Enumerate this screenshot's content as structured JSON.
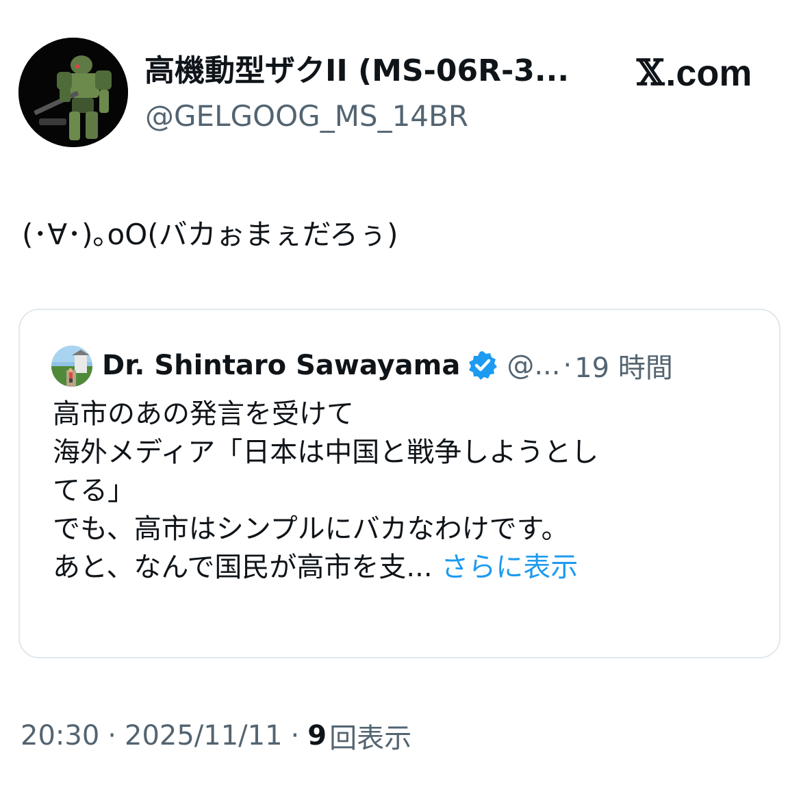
{
  "author": {
    "display_name": "高機動型ザクII (MS-06R-3...",
    "handle": "@GELGOOG_MS_14BR",
    "avatar_icon": "mobile-suit-avatar-icon"
  },
  "brand": {
    "x_symbol": "𝕏",
    "domain": ".com"
  },
  "tweet": {
    "text": "(･∀･)｡oO(バカぉまぇだろぅ)"
  },
  "quote": {
    "avatar_icon": "person-on-stairs-avatar-icon",
    "name": "Dr. Shintaro Sawayama",
    "verified_icon": "verified-badge-icon",
    "handle": "@...",
    "separator": "·",
    "time": "19 時間",
    "lines": [
      "高市のあの発言を受けて",
      "海外メディア「日本は中国と戦争しようとし",
      "てる」",
      "でも、高市はシンプルにバカなわけです。"
    ],
    "last_line": "あと、なんで国民が高市を支...",
    "show_more": "さらに表示"
  },
  "meta": {
    "time": "20:30",
    "separator": "·",
    "date": "2025/11/11",
    "views_count": "9",
    "views_label": "回表示"
  },
  "colors": {
    "text_primary": "#0f1419",
    "text_secondary": "#536471",
    "link": "#1d9bf0",
    "border": "#e1e8ed",
    "verified": "#1d9bf0"
  }
}
